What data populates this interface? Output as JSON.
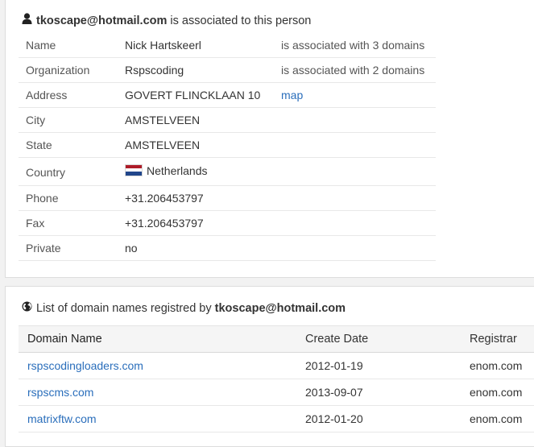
{
  "person": {
    "heading_email": "tkoscape@hotmail.com",
    "heading_suffix": " is associated to this person",
    "icon": "user-icon",
    "rows": [
      {
        "label": "Name",
        "value": "Nick Hartskeerl",
        "value_link": true,
        "extra": "is associated with 3 domains"
      },
      {
        "label": "Organization",
        "value": "Rspscoding",
        "value_link": true,
        "extra": "is associated with 2 domains"
      },
      {
        "label": "Address",
        "value": "GOVERT FLINCKLAAN 10",
        "value_link": false,
        "extra": "map",
        "extra_link": true
      },
      {
        "label": "City",
        "value": "AMSTELVEEN"
      },
      {
        "label": "State",
        "value": "AMSTELVEEN"
      },
      {
        "label": "Country",
        "value": "Netherlands",
        "flag": "netherlands-flag"
      },
      {
        "label": "Phone",
        "value": "+31.206453797"
      },
      {
        "label": "Fax",
        "value": "+31.206453797"
      },
      {
        "label": "Private",
        "value": "no"
      }
    ]
  },
  "domains": {
    "heading_prefix": "List of domain names registred by ",
    "heading_email": "tkoscape@hotmail.com",
    "icon": "globe-icon",
    "columns": [
      "Domain Name",
      "Create Date",
      "Registrar"
    ],
    "rows": [
      {
        "domain": "rspscodingloaders.com",
        "created": "2012-01-19",
        "registrar": "enom.com"
      },
      {
        "domain": "rspscms.com",
        "created": "2013-09-07",
        "registrar": "enom.com"
      },
      {
        "domain": "matrixftw.com",
        "created": "2012-01-20",
        "registrar": "enom.com"
      }
    ]
  },
  "colors": {
    "link": "#2a6ebb",
    "flag_red": "#ae1c28",
    "flag_white": "#ffffff",
    "flag_blue": "#21468b"
  }
}
